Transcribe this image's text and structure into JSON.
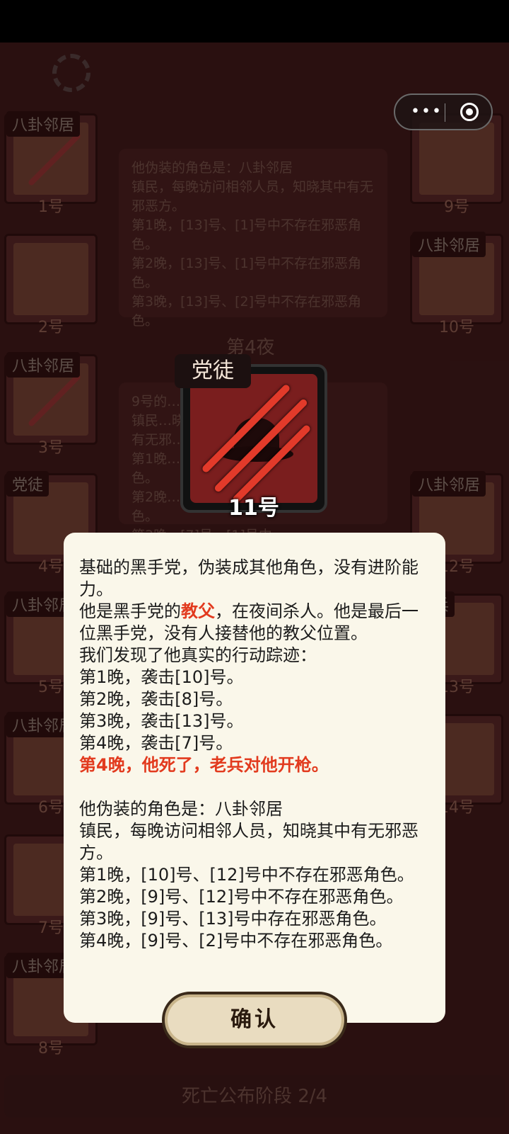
{
  "background": {
    "left_column": [
      {
        "tag": "八卦邻居",
        "num": "1号"
      },
      {
        "tag": "",
        "num": "2号"
      },
      {
        "tag": "八卦邻居",
        "num": "3号"
      },
      {
        "tag": "党徒",
        "num": "4号"
      },
      {
        "tag": "八卦邻居",
        "num": "5号"
      },
      {
        "tag": "八卦邻居",
        "num": "6号"
      },
      {
        "tag": "",
        "num": "7号"
      },
      {
        "tag": "八卦邻居",
        "num": "8号"
      }
    ],
    "right_column": [
      {
        "tag": "",
        "num": "9号"
      },
      {
        "tag": "八卦邻居",
        "num": "10号"
      },
      {
        "tag": "八卦邻居",
        "num": "12号"
      },
      {
        "tag": "老兵",
        "num": "13号"
      },
      {
        "tag": "",
        "num": "14号"
      }
    ],
    "log_top": "他伪装的角色是：八卦邻居\n镇民，每晚访问相邻人员，知晓其中有无邪恶方。\n第1晚，[13]号、[1]号中不存在邪恶角色。\n第2晚，[13]号、[1]号中不存在邪恶角色。\n第3晚，[13]号、[2]号中不存在邪恶角色。",
    "night_label": "第4夜",
    "log_bottom": "9号的…\n镇民…晓其中\n有无邪…\n第1晚…邪恶角\n色。\n第2晚…恶角\n色。\n第3晚，[7]号、[1]号中",
    "phase": "死亡公布阶段 2/4"
  },
  "capsule": {
    "dots": "•••"
  },
  "card": {
    "role_tag": "党徒",
    "seat": "11号",
    "art_icon": "clawed-hat-icon"
  },
  "dialog": {
    "p1": "基础的黑手党，伪装成其他角色，没有进阶能力。",
    "p2_a": "他是黑手党的",
    "p2_red": "教父",
    "p2_b": "，在夜间杀人。他是最后一位黑手党，没有人接替他的教父位置。",
    "p3": "我们发现了他真实的行动踪迹：",
    "n1": "第1晚，袭击[10]号。",
    "n2": "第2晚，袭击[8]号。",
    "n3": "第3晚，袭击[13]号。",
    "n4": "第4晚，袭击[7]号。",
    "death": "第4晚，他死了，老兵对他开枪。",
    "disguise": "他伪装的角色是：八卦邻居",
    "disguise_desc": "镇民，每晚访问相邻人员，知晓其中有无邪恶方。",
    "c1": "第1晚，[10]号、[12]号中不存在邪恶角色。",
    "c2": "第2晚，[9]号、[12]号中不存在邪恶角色。",
    "c3": "第3晚，[9]号、[13]号中存在邪恶角色。",
    "c4": "第4晚，[9]号、[2]号中不存在邪恶角色。"
  },
  "confirm_label": "确认",
  "colors": {
    "accent_red": "#e23a1e",
    "dialog_bg": "#faf7ea"
  }
}
